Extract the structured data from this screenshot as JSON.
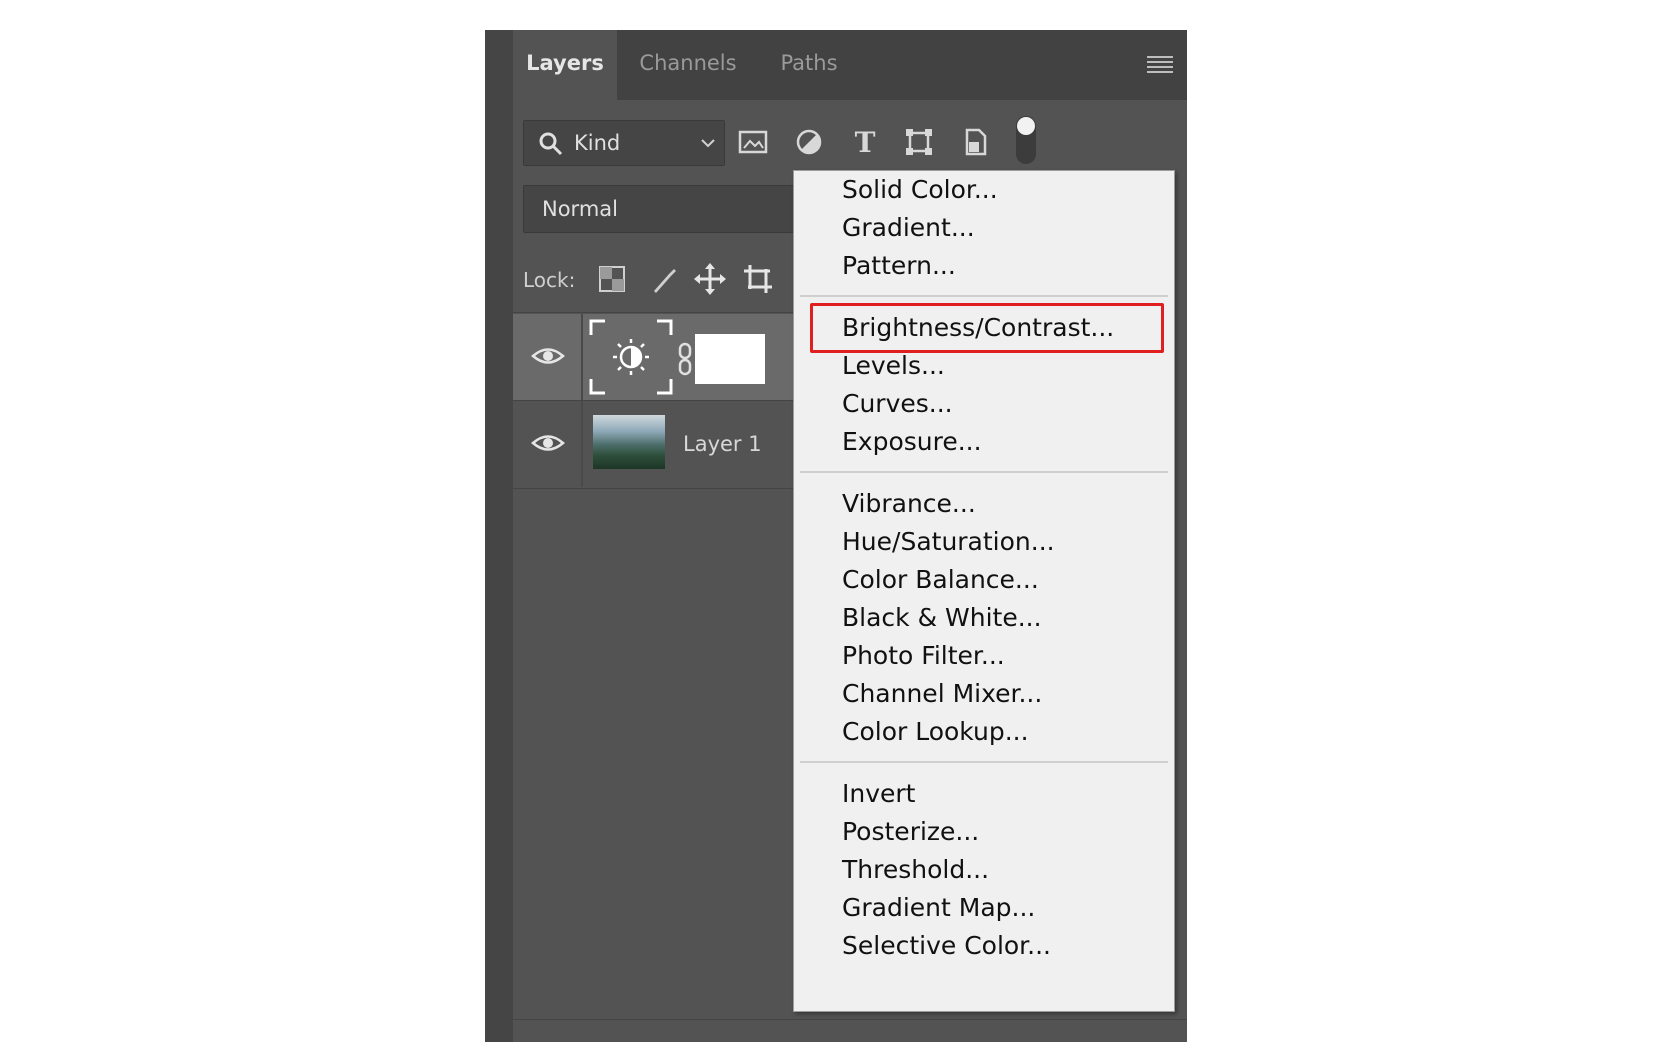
{
  "panel": {
    "tabs": [
      "Layers",
      "Channels",
      "Paths"
    ],
    "active_tab": "Layers",
    "filter": {
      "kind_label": "Kind"
    },
    "blend_mode": "Normal",
    "lock_label": "Lock:",
    "layers": [
      {
        "name": "",
        "type": "adjustment-brightness-contrast",
        "visible": true,
        "selected": true
      },
      {
        "name": "Layer 1",
        "type": "image",
        "visible": true,
        "selected": false
      }
    ]
  },
  "adjustment_menu": {
    "groups": [
      [
        "Solid Color...",
        "Gradient...",
        "Pattern..."
      ],
      [
        "Brightness/Contrast...",
        "Levels...",
        "Curves...",
        "Exposure..."
      ],
      [
        "Vibrance...",
        "Hue/Saturation...",
        "Color Balance...",
        "Black & White...",
        "Photo Filter...",
        "Channel Mixer...",
        "Color Lookup..."
      ],
      [
        "Invert",
        "Posterize...",
        "Threshold...",
        "Gradient Map...",
        "Selective Color..."
      ]
    ],
    "highlighted": "Brightness/Contrast..."
  },
  "colors": {
    "highlight": "#e02020",
    "panel_bg": "#535353",
    "menu_bg": "#f0f0f0"
  }
}
